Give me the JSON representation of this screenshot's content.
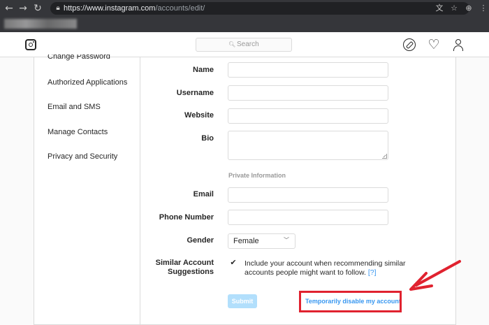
{
  "browser": {
    "url_host": "https://www.instagram.com",
    "url_path": "/accounts/edit/",
    "icons": {
      "back": "back-arrow-icon",
      "forward": "forward-arrow-icon",
      "reload": "reload-icon",
      "lock": "lock-icon",
      "translate": "translate-icon",
      "bookmark": "star-icon",
      "extension": "extension-icon",
      "menu": "menu-icon"
    }
  },
  "header": {
    "search_placeholder": "Search",
    "icons": [
      "instagram-logo-icon",
      "compass-icon",
      "heart-icon",
      "user-icon"
    ]
  },
  "sidebar": {
    "items": [
      {
        "label": "Change Password"
      },
      {
        "label": "Authorized Applications"
      },
      {
        "label": "Email and SMS"
      },
      {
        "label": "Manage Contacts"
      },
      {
        "label": "Privacy and Security"
      }
    ]
  },
  "form": {
    "name_label": "Name",
    "username_label": "Username",
    "website_label": "Website",
    "bio_label": "Bio",
    "private_info_title": "Private Information",
    "email_label": "Email",
    "phone_label": "Phone Number",
    "gender_label": "Gender",
    "gender_value": "Female",
    "suggestions_label_line1": "Similar Account",
    "suggestions_label_line2": "Suggestions",
    "suggestions_checked": true,
    "suggestions_text": "Include your account when recommending similar accounts people might want to follow.",
    "suggestions_help": "[?]",
    "submit_label": "Submit",
    "disable_link": "Temporarily disable my account"
  },
  "colors": {
    "accent": "#3897f0",
    "submit_disabled": "#b2dffc",
    "annotation_red": "#e0222f",
    "border": "#dbdbdb"
  }
}
